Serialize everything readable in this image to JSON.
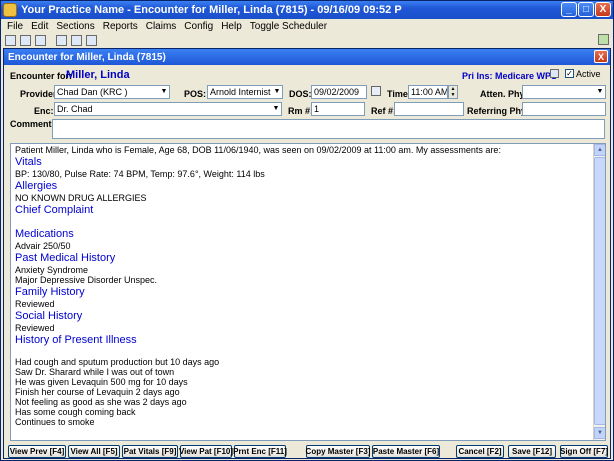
{
  "window": {
    "title": "Your Practice Name - Encounter for Miller, Linda (7815) - 09/16/09 09:52 P",
    "minimize": "_",
    "maximize": "□",
    "close": "X"
  },
  "menu": [
    "File",
    "Edit",
    "Sections",
    "Reports",
    "Claims",
    "Config",
    "Help",
    "Toggle Scheduler"
  ],
  "inner": {
    "title": "Encounter for Miller, Linda (7815)",
    "close": "X"
  },
  "header": {
    "encounter_for_label": "Encounter for:",
    "patient_name": "Miller, Linda",
    "pri_ins": "Pri Ins: Medicare WPS",
    "active_label": "Active",
    "active_checked": "✓"
  },
  "fields": {
    "provider_label": "Provider:",
    "provider_value": "Chad Dan (KRC )",
    "pos_label": "POS:",
    "pos_value": "Arnold Internist",
    "dos_label": "DOS:",
    "dos_value": "09/02/2009",
    "time_label": "Time:",
    "time_value": "11:00 AM",
    "atten_label": "Atten. Phys:",
    "atten_value": "",
    "enc_label": "Enc:",
    "enc_value": "Dr. Chad",
    "rm_label": "Rm #:",
    "rm_value": "1",
    "ref_label": "Ref #:",
    "ref_value": "",
    "referring_label": "Referring Phys:",
    "referring_value": "",
    "comments_label": "Comments:",
    "comments_value": ""
  },
  "note": {
    "intro": "Patient Miller, Linda who is Female, Age 68, DOB 11/06/1940, was seen on 09/02/2009 at 11:00 am. My assessments are:",
    "vitals_h": "Vitals",
    "vitals": "BP: 130/80,    Pulse Rate: 74 BPM,    Temp: 97.6°,    Weight: 114 lbs",
    "allergies_h": "Allergies",
    "allergies": "NO KNOWN DRUG ALLERGIES",
    "chief_h": "Chief Complaint",
    "medications_h": "Medications",
    "medications": "Advair 250/50",
    "pmh_h": "Past Medical History",
    "pmh_1": "Anxiety Syndrome",
    "pmh_2": "Major Depressive Disorder Unspec.",
    "family_h": "Family History",
    "family": "Reviewed",
    "social_h": "Social History",
    "social": "Reviewed",
    "hpi_h": "History of Present Illness",
    "hpi_1": "Had cough and sputum production but 10 days ago",
    "hpi_2": "Saw Dr. Sharard while I was out of town",
    "hpi_3": "He was given Levaquin 500 mg for 10 days",
    "hpi_4": "Finish her course of Levaquin 2 days ago",
    "hpi_5": "Not feeling as good as she was 2 days ago",
    "hpi_6": "Has some cough coming back",
    "hpi_7": "Continues to smoke"
  },
  "buttons": {
    "view_prev": "View Prev [F4]",
    "view_all": "View All [F5]",
    "pat_vitals": "Pat Vitals [F9]",
    "view_pat": "View Pat [F10]",
    "prnt_enc": "Prnt Enc [F11]",
    "copy_master": "Copy Master [F3]",
    "paste_master": "Paste Master [F6]",
    "cancel": "Cancel [F2]",
    "save": "Save [F12]",
    "sign_off": "Sign Off [F7]"
  }
}
